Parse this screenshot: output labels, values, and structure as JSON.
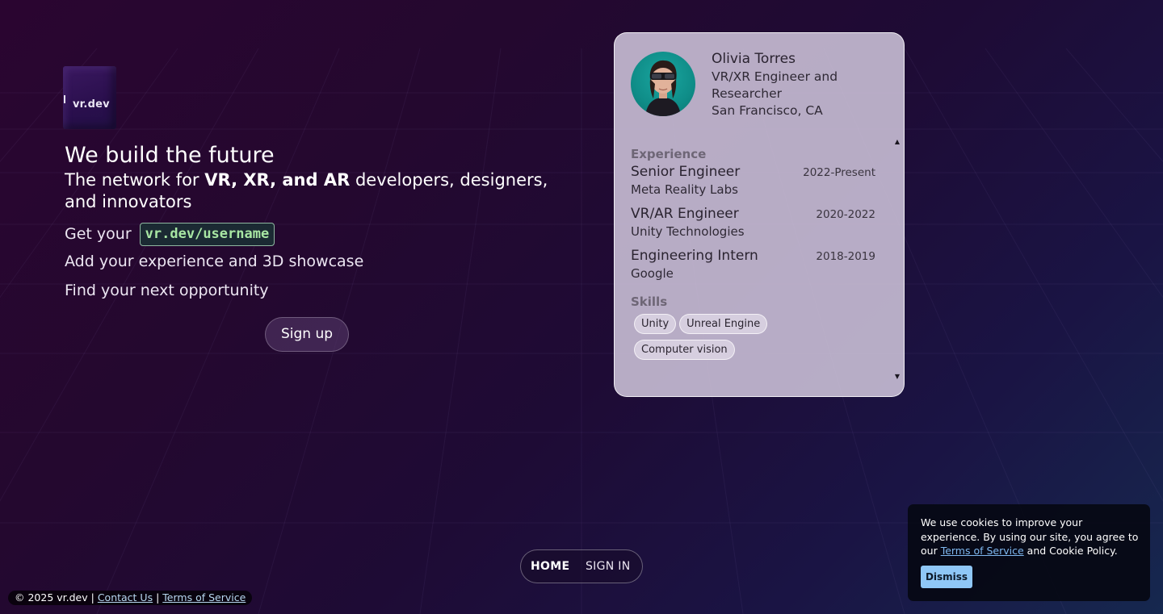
{
  "brand": {
    "logo_text": "vr.dev"
  },
  "hero": {
    "title": "We build the future",
    "subtitle_prefix": "The network for ",
    "subtitle_bold": "VR, XR, and AR",
    "subtitle_suffix": " developers, designers, and innovators",
    "username_prefix": "Get your ",
    "username_url": "vr.dev/username",
    "line_experience": "Add your experience and 3D showcase",
    "line_opportunity": "Find your next opportunity",
    "signup_label": "Sign up"
  },
  "profile": {
    "name": "Olivia Torres",
    "title": "VR/XR Engineer and Researcher",
    "location": "San Francisco, CA",
    "experience_heading": "Experience",
    "experience": [
      {
        "role": "Senior Engineer",
        "company": "Meta Reality Labs",
        "dates": "2022-Present"
      },
      {
        "role": "VR/AR Engineer",
        "company": "Unity Technologies",
        "dates": "2020-2022"
      },
      {
        "role": "Engineering Intern",
        "company": "Google",
        "dates": "2018-2019"
      }
    ],
    "skills_heading": "Skills",
    "skills": [
      "Unity",
      "Unreal Engine",
      "Computer vision"
    ],
    "scroll_up_icon": "▲",
    "scroll_down_icon": "▼"
  },
  "nav": {
    "home_label": "HOME",
    "signin_label": "SIGN IN"
  },
  "footer": {
    "copyright": "© 2025 vr.dev",
    "separator": " | ",
    "contact_label": "Contact Us",
    "terms_label": "Terms of Service"
  },
  "cookie": {
    "text_before": "We use cookies to improve your experience. By using our site, you agree to our ",
    "terms_link": "Terms of Service",
    "text_after": " and Cookie Policy.",
    "dismiss_label": "Dismiss"
  },
  "colors": {
    "accent_url": "#a8e6a3",
    "link": "#7fb8f0",
    "dismiss_bg": "#8fc7f7"
  }
}
